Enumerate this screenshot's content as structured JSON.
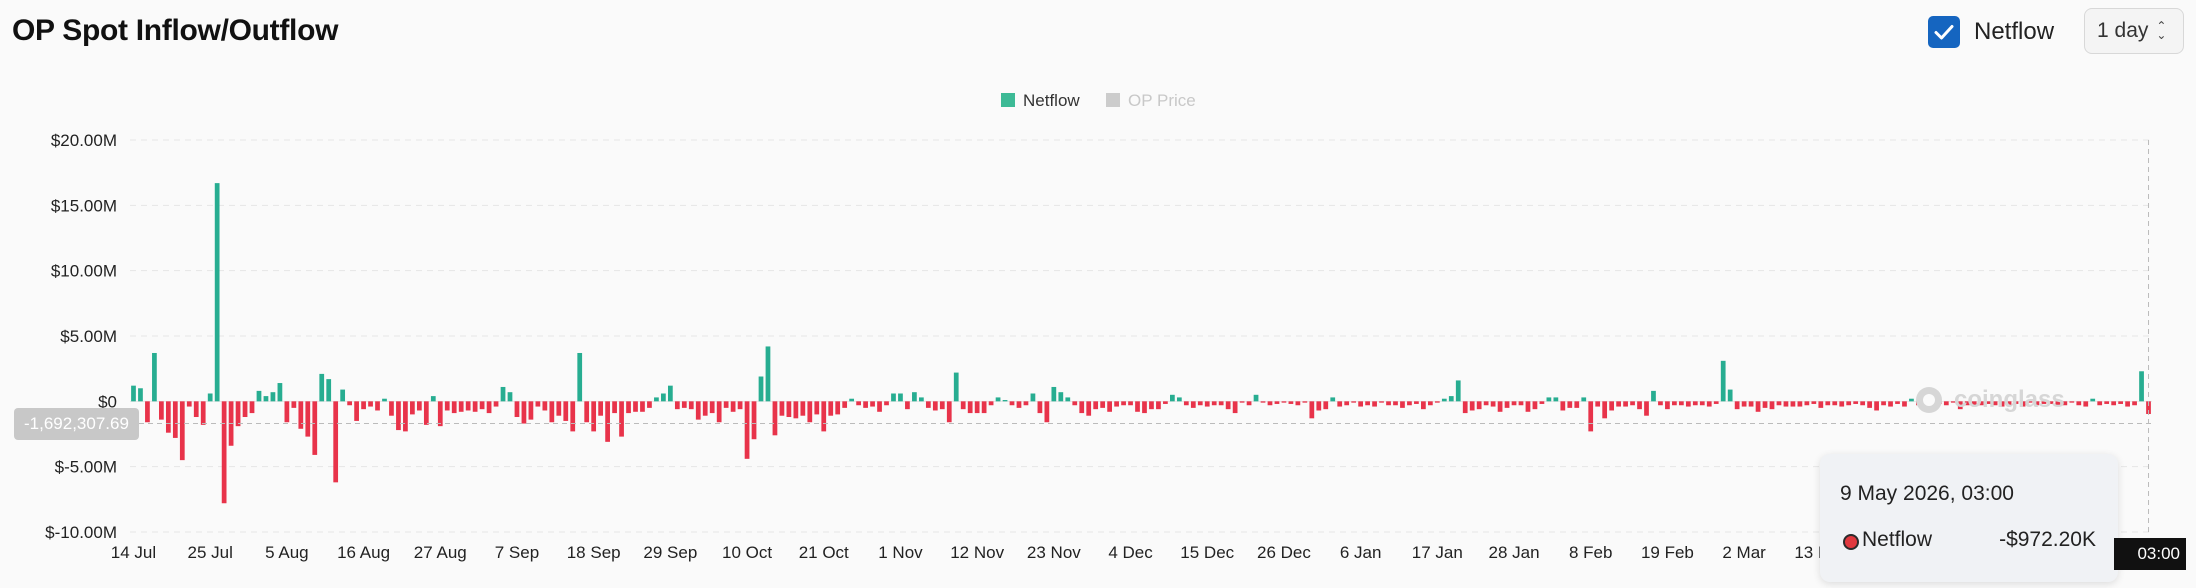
{
  "header": {
    "title": "OP Spot Inflow/Outflow",
    "netflow_toggle_label": "Netflow",
    "range_value": "1 day"
  },
  "legend": {
    "series": [
      {
        "name": "Netflow",
        "color": "#3dba96",
        "active": true
      },
      {
        "name": "OP Price",
        "color": "#cccccc",
        "active": false
      }
    ]
  },
  "colors": {
    "positive": "#27ad91",
    "negative": "#e8334a",
    "grid": "#e6e6e6",
    "axis_text": "#222222"
  },
  "tooltip": {
    "date": "9 May 2026, 03:00",
    "series": "Netflow",
    "value": "-$972.20K"
  },
  "crosshair": {
    "y_value_label": "-1,692,307.69",
    "x_time_label": "03:00"
  },
  "watermark": "coinglass",
  "chart_data": {
    "type": "bar",
    "title": "OP Spot Inflow/Outflow",
    "ylim": [
      -10000000,
      20000000
    ],
    "y_ticks": [
      {
        "value": 20000000,
        "label": "$20.00M"
      },
      {
        "value": 15000000,
        "label": "$15.00M"
      },
      {
        "value": 10000000,
        "label": "$10.00M"
      },
      {
        "value": 5000000,
        "label": "$5.00M"
      },
      {
        "value": 0,
        "label": "$0"
      },
      {
        "value": -5000000,
        "label": "$-5.00M"
      },
      {
        "value": -10000000,
        "label": "$-10.00M"
      }
    ],
    "x_ticks": [
      {
        "index": 0,
        "label": "14 Jul"
      },
      {
        "index": 11,
        "label": "25 Jul"
      },
      {
        "index": 22,
        "label": "5 Aug"
      },
      {
        "index": 33,
        "label": "16 Aug"
      },
      {
        "index": 44,
        "label": "27 Aug"
      },
      {
        "index": 55,
        "label": "7 Sep"
      },
      {
        "index": 66,
        "label": "18 Sep"
      },
      {
        "index": 77,
        "label": "29 Sep"
      },
      {
        "index": 88,
        "label": "10 Oct"
      },
      {
        "index": 99,
        "label": "21 Oct"
      },
      {
        "index": 110,
        "label": "1 Nov"
      },
      {
        "index": 121,
        "label": "12 Nov"
      },
      {
        "index": 132,
        "label": "23 Nov"
      },
      {
        "index": 143,
        "label": "4 Dec"
      },
      {
        "index": 154,
        "label": "15 Dec"
      },
      {
        "index": 165,
        "label": "26 Dec"
      },
      {
        "index": 176,
        "label": "6 Jan"
      },
      {
        "index": 187,
        "label": "17 Jan"
      },
      {
        "index": 198,
        "label": "28 Jan"
      },
      {
        "index": 209,
        "label": "8 Feb"
      },
      {
        "index": 220,
        "label": "19 Feb"
      },
      {
        "index": 231,
        "label": "2 Mar"
      },
      {
        "index": 242,
        "label": "13 Mar"
      }
    ],
    "grid": true,
    "legend_position": "top-center",
    "series": [
      {
        "name": "Netflow",
        "values": [
          1.2,
          1.0,
          -1.6,
          3.7,
          -1.4,
          -2.4,
          -2.8,
          -4.5,
          -0.4,
          -1.2,
          -1.8,
          0.6,
          16.7,
          -7.8,
          -3.4,
          -1.9,
          -1.2,
          -0.9,
          0.8,
          0.4,
          0.7,
          1.4,
          -1.6,
          -0.5,
          -2.1,
          -2.7,
          -4.1,
          2.1,
          1.7,
          -6.2,
          0.9,
          -0.3,
          -1.5,
          -0.6,
          -0.4,
          -0.7,
          0.2,
          -1.1,
          -2.2,
          -2.3,
          -1.0,
          -0.7,
          -1.8,
          0.4,
          -1.9,
          -0.7,
          -0.9,
          -0.8,
          -0.7,
          -0.8,
          -0.6,
          -0.9,
          -0.4,
          1.1,
          0.7,
          -1.2,
          -1.7,
          -1.4,
          -0.4,
          -0.7,
          -1.6,
          -1.1,
          -1.5,
          -2.3,
          3.7,
          -1.6,
          -2.3,
          -1.1,
          -3.1,
          -0.9,
          -2.7,
          -0.9,
          -0.8,
          -0.8,
          -0.5,
          0.3,
          0.6,
          1.2,
          -0.6,
          -0.5,
          -0.6,
          -1.4,
          -1.1,
          -0.9,
          -1.6,
          -0.5,
          -0.8,
          -0.6,
          -4.4,
          -2.9,
          1.9,
          4.2,
          -2.6,
          -1.1,
          -1.2,
          -1.3,
          -1.1,
          -1.6,
          -1.0,
          -2.3,
          -1.1,
          -1.0,
          -0.5,
          0.2,
          -0.3,
          -0.5,
          -0.4,
          -0.8,
          -0.3,
          0.6,
          0.6,
          -0.6,
          0.7,
          0.3,
          -0.5,
          -0.7,
          -0.6,
          -1.6,
          2.2,
          -0.6,
          -0.9,
          -0.9,
          -0.9,
          -0.3,
          0.3,
          0.1,
          -0.3,
          -0.5,
          -0.3,
          0.6,
          -0.9,
          -1.6,
          1.1,
          0.7,
          0.3,
          -0.3,
          -0.9,
          -1.1,
          -0.6,
          -0.5,
          -0.8,
          -0.4,
          -0.3,
          -0.3,
          -0.8,
          -0.9,
          -0.6,
          -0.6,
          -0.2,
          0.5,
          0.3,
          -0.3,
          -0.5,
          -0.3,
          -0.4,
          -0.3,
          -0.3,
          -0.6,
          -0.9,
          -0.1,
          -0.3,
          0.5,
          -0.1,
          -0.3,
          -0.2,
          -0.1,
          -0.2,
          -0.3,
          -0.1,
          -1.3,
          -0.7,
          -0.6,
          0.3,
          -0.4,
          -0.3,
          -0.1,
          -0.4,
          -0.3,
          -0.4,
          -0.1,
          -0.3,
          -0.3,
          -0.5,
          -0.3,
          -0.2,
          -0.6,
          -0.3,
          -0.1,
          0.2,
          0.4,
          1.6,
          -0.9,
          -0.7,
          -0.6,
          -0.3,
          -0.4,
          -0.8,
          -0.5,
          -0.3,
          -0.3,
          -0.8,
          -0.6,
          -0.2,
          0.3,
          0.3,
          -0.7,
          -0.5,
          -0.5,
          0.3,
          -2.3,
          -0.4,
          -1.3,
          -0.7,
          -0.4,
          -0.4,
          -0.3,
          -0.6,
          -1.1,
          0.8,
          -0.3,
          -0.6,
          -0.3,
          -0.3,
          -0.4,
          -0.3,
          -0.3,
          -0.4,
          -0.2,
          3.1,
          0.9,
          -0.6,
          -0.4,
          -0.4,
          -0.8,
          -0.5,
          -0.6,
          -0.3,
          -0.4,
          -0.4,
          -0.4,
          -0.3,
          -0.2,
          -0.5,
          -0.3,
          -0.3,
          -0.4,
          -0.3,
          -0.2,
          -0.3,
          -0.5,
          -0.7,
          -0.3,
          -0.4,
          -0.2,
          -0.4,
          0.2,
          -0.3,
          -0.3,
          -0.4,
          -0.2,
          -0.3,
          -0.1,
          -0.6,
          -0.3,
          -0.4,
          -0.3,
          -0.2,
          -0.3,
          -0.4,
          -0.3,
          -0.2,
          -0.4,
          -0.1,
          -0.3,
          -0.2,
          -0.2,
          -0.3,
          -0.3,
          -0.1,
          -0.3,
          -0.4,
          0.2,
          -0.3,
          -0.2,
          -0.3,
          -0.2,
          -0.4,
          -0.3,
          2.3,
          -0.97
        ]
      }
    ]
  }
}
